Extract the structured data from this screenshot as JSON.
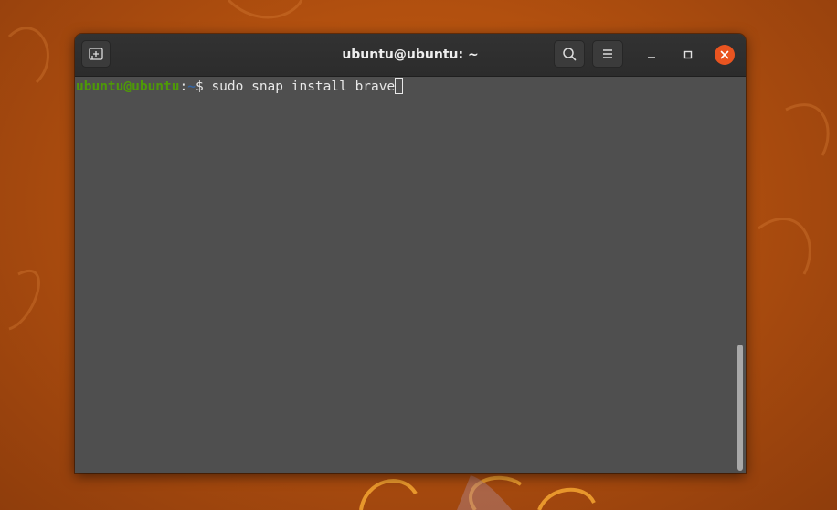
{
  "window": {
    "title": "ubuntu@ubuntu: ~"
  },
  "headerbar": {
    "new_tab_icon": "new-tab-icon",
    "search_icon": "search-icon",
    "menu_icon": "hamburger-menu-icon",
    "minimize_icon": "minimize-icon",
    "maximize_icon": "maximize-icon",
    "close_icon": "close-icon"
  },
  "terminal": {
    "prompt_user": "ubuntu@ubuntu",
    "prompt_sep": ":",
    "prompt_path": "~",
    "prompt_symbol": "$ ",
    "command": "sudo snap install brave"
  },
  "colors": {
    "accent": "#e95420",
    "prompt_user": "#4e9a06",
    "prompt_path": "#3465a4",
    "terminal_bg": "#4f4f4f",
    "headerbar_bg": "#2f2f2f"
  }
}
